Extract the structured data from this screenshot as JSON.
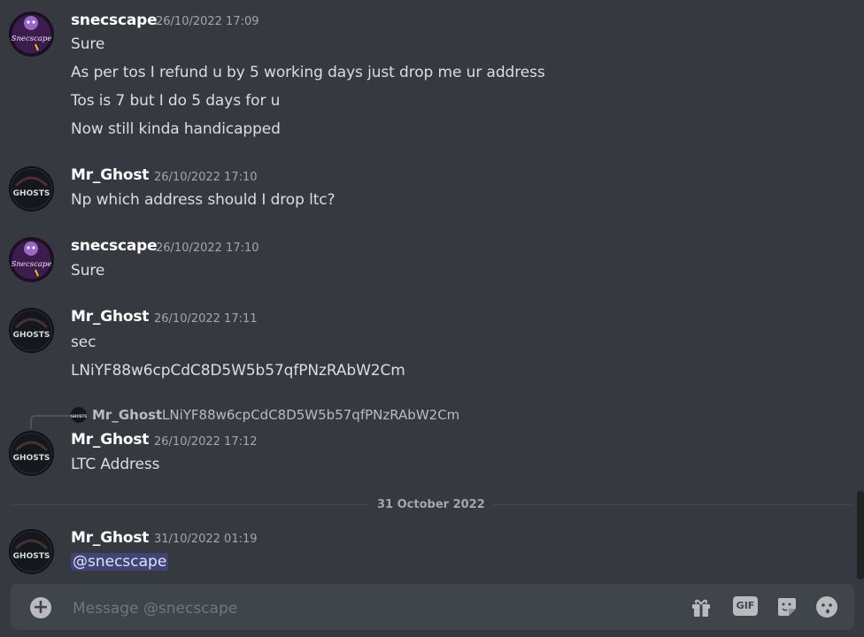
{
  "colors": {
    "background": "#36393f",
    "composer": "#40444b",
    "mention_bg": "#5865f2"
  },
  "messages": [
    {
      "author": "snecscape",
      "timestamp": "26/10/2022 17:09",
      "avatar": "snecscape-avatar",
      "lines": [
        "Sure",
        "As per tos I refund u by 5 working days just drop me ur address",
        "Tos is 7 but I do 5 days for u",
        "Now still kinda handicapped"
      ]
    },
    {
      "author": "Mr_Ghost",
      "timestamp": "26/10/2022 17:10",
      "avatar": "ghosts-avatar",
      "lines": [
        "Np which address should I drop ltc?"
      ]
    },
    {
      "author": "snecscape",
      "timestamp": "26/10/2022 17:10",
      "avatar": "snecscape-avatar",
      "lines": [
        "Sure"
      ]
    },
    {
      "author": "Mr_Ghost",
      "timestamp": "26/10/2022 17:11",
      "avatar": "ghosts-avatar",
      "lines": [
        "sec",
        "LNiYF88w6cpCdC8D5W5b57qfPNzRAbW2Cm"
      ]
    },
    {
      "reply": {
        "author": "Mr_Ghost",
        "text": "LNiYF88w6cpCdC8D5W5b57qfPNzRAbW2Cm"
      },
      "author": "Mr_Ghost",
      "timestamp": "26/10/2022 17:12",
      "avatar": "ghosts-avatar",
      "lines": [
        "LTC Address"
      ]
    },
    {
      "author": "Mr_Ghost",
      "timestamp": "31/10/2022 01:19",
      "avatar": "ghosts-avatar",
      "mention": "@snecscape"
    }
  ],
  "date_divider": "31 October 2022",
  "avatar_text": {
    "snecscape": "Snecscape",
    "ghosts": "GHOSTS"
  },
  "composer": {
    "placeholder": "Message @snecscape",
    "gif_label": "GIF",
    "icons": [
      "add-attachment-icon",
      "gift-icon",
      "gif-icon",
      "sticker-icon",
      "emoji-icon"
    ]
  }
}
